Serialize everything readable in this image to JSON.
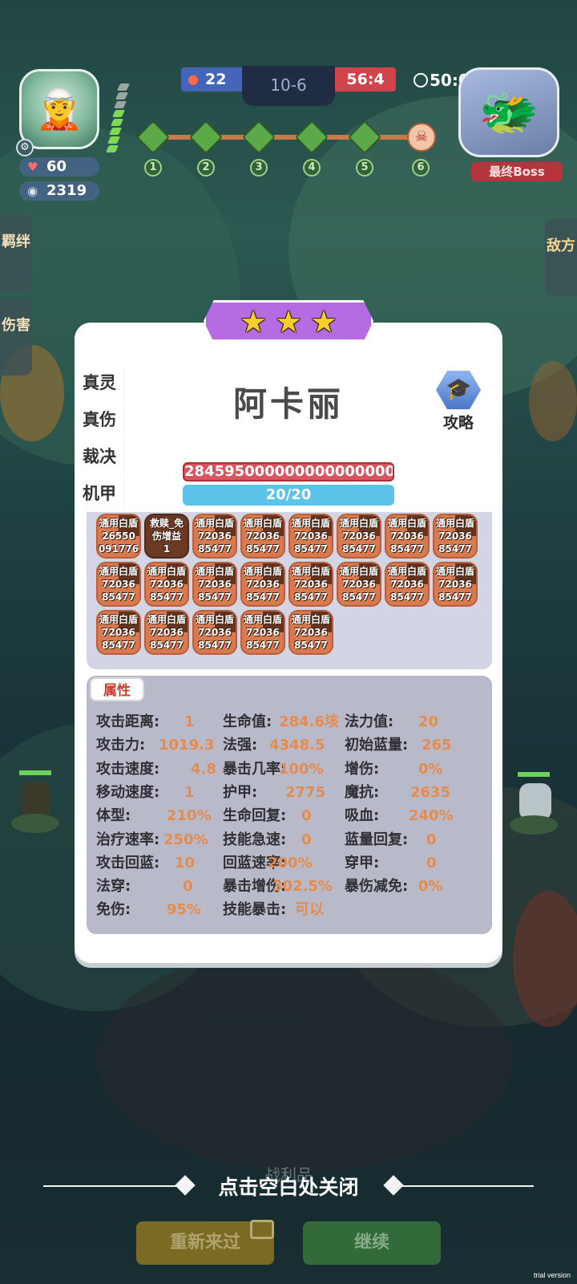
{
  "hud": {
    "hp": "60",
    "coins": "2319",
    "score_left": "22",
    "round": "10-6",
    "score_right": "56:4",
    "timer": "50:0",
    "boss_label": "最终Boss",
    "stages": [
      "1",
      "2",
      "3",
      "4",
      "5",
      "6"
    ]
  },
  "side_tabs": {
    "left": [
      "羁绊",
      "伤害"
    ],
    "right": "敌方"
  },
  "modal": {
    "stars": 3,
    "name": "阿卡丽",
    "guide_label": "攻略",
    "tabs": [
      "真灵",
      "真伤",
      "裁决",
      "机甲"
    ],
    "hp_value": "2845950000000000000000",
    "mana_value": "20/20",
    "items": [
      {
        "text": "通用白盾\n26550\n091776",
        "style": "light"
      },
      {
        "text": "救赎_免\n伤增益\n1",
        "style": "dark"
      },
      {
        "text": "通用白盾\n72036\n85477",
        "style": "light"
      },
      {
        "text": "通用白盾\n72036\n85477",
        "style": "light"
      },
      {
        "text": "通用白盾\n72036\n85477",
        "style": "light"
      },
      {
        "text": "通用白盾\n72036\n85477",
        "style": "light"
      },
      {
        "text": "通用白盾\n72036\n85477",
        "style": "light"
      },
      {
        "text": "通用白盾\n72036\n85477",
        "style": "light"
      },
      {
        "text": "通用白盾\n72036\n85477",
        "style": "light"
      },
      {
        "text": "通用白盾\n72036\n85477",
        "style": "light"
      },
      {
        "text": "通用白盾\n72036\n85477",
        "style": "light"
      },
      {
        "text": "通用白盾\n72036\n85477",
        "style": "light"
      },
      {
        "text": "通用白盾\n72036\n85477",
        "style": "light"
      },
      {
        "text": "通用白盾\n72036\n85477",
        "style": "light"
      },
      {
        "text": "通用白盾\n72036\n85477",
        "style": "light"
      },
      {
        "text": "通用白盾\n72036\n85477",
        "style": "light"
      },
      {
        "text": "通用白盾\n72036\n85477",
        "style": "light"
      },
      {
        "text": "通用白盾\n72036\n85477",
        "style": "light"
      },
      {
        "text": "通用白盾\n72036\n85477",
        "style": "light"
      },
      {
        "text": "通用白盾\n72036\n85477",
        "style": "light"
      },
      {
        "text": "通用白盾\n72036\n85477",
        "style": "light"
      }
    ],
    "attributes_title": "属性",
    "attributes": [
      [
        [
          "攻击距离:",
          "1"
        ],
        [
          "生命值:",
          "284.6垓"
        ],
        [
          "法力值:",
          "20"
        ]
      ],
      [
        [
          "攻击力:",
          "1019.3"
        ],
        [
          "法强:",
          "4348.5"
        ],
        [
          "初始蓝量:",
          "265"
        ]
      ],
      [
        [
          "攻击速度:",
          "4.8"
        ],
        [
          "暴击几率:",
          "100%"
        ],
        [
          "增伤:",
          "0%"
        ]
      ],
      [
        [
          "移动速度:",
          "1"
        ],
        [
          "护甲:",
          "2775"
        ],
        [
          "魔抗:",
          "2635"
        ]
      ],
      [
        [
          "体型:",
          "210%"
        ],
        [
          "生命回复:",
          "0"
        ],
        [
          "吸血:",
          "240%"
        ]
      ],
      [
        [
          "治疗速率:",
          "250%"
        ],
        [
          "技能急速:",
          "0"
        ],
        [
          "蓝量回复:",
          "0"
        ]
      ],
      [
        [
          "攻击回蓝:",
          "10"
        ],
        [
          "回蓝速率:",
          "200%"
        ],
        [
          "穿甲:",
          "0"
        ]
      ],
      [
        [
          "法穿:",
          "0"
        ],
        [
          "暴击增伤:",
          "302.5%"
        ],
        [
          "暴伤减免:",
          "0%"
        ]
      ],
      [
        [
          "免伤:",
          "95%"
        ],
        [
          "技能暴击:",
          "可以"
        ],
        [
          "",
          ""
        ]
      ]
    ]
  },
  "footer": {
    "close_hint": "点击空白处关闭",
    "loot_label": "战利品",
    "retry_label": "重新来过",
    "continue_label": "继续",
    "watermark": "trial version"
  }
}
